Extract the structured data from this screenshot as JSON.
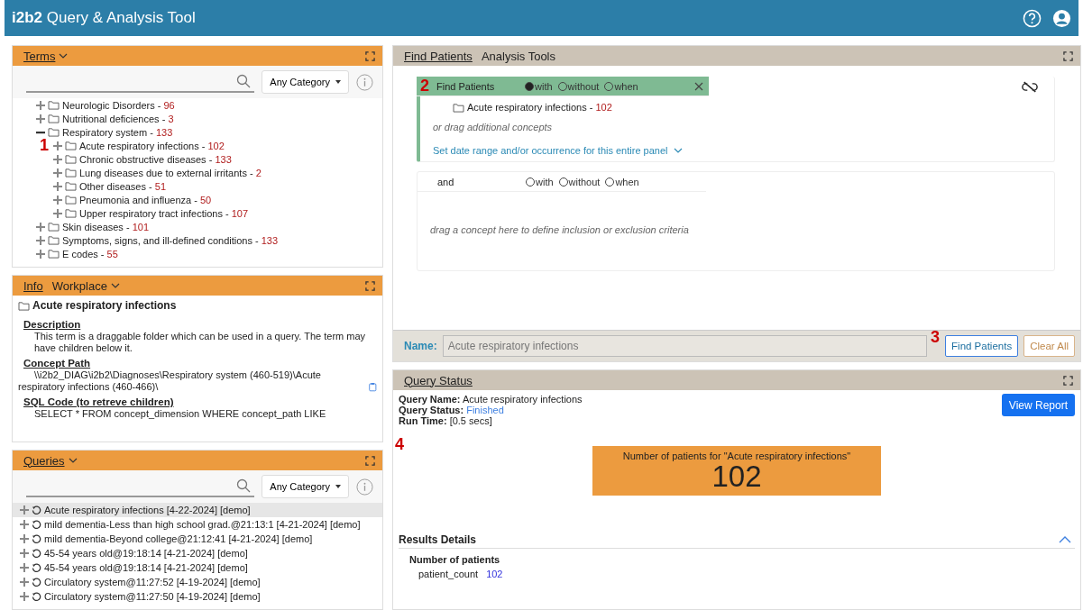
{
  "app_bar": {
    "title": "**i2b2** Query & Analysis Tool"
  },
  "terms_panel": {
    "tab": "Terms",
    "category": "Any Category",
    "tree": [
      {
        "label": "Neurologic Disorders -",
        "count": "96",
        "expanded": false
      },
      {
        "label": "Nutritional deficiences -",
        "count": "3",
        "expanded": false
      },
      {
        "label": "Respiratory system -",
        "count": "133",
        "expanded": true,
        "children": [
          {
            "label": "Acute respiratory infections -",
            "count": "102",
            "expanded": false,
            "marker": "1"
          },
          {
            "label": "Chronic obstructive diseases -",
            "count": "133",
            "expanded": false
          },
          {
            "label": "Lung diseases due to external irritants -",
            "count": "2",
            "expanded": false
          },
          {
            "label": "Other diseases -",
            "count": "51",
            "expanded": false
          },
          {
            "label": "Pneumonia and influenza -",
            "count": "50",
            "expanded": false
          },
          {
            "label": "Upper respiratory tract infections -",
            "count": "107",
            "expanded": false
          }
        ]
      },
      {
        "label": "Skin diseases -",
        "count": "101",
        "expanded": false
      },
      {
        "label": "Symptoms, signs, and ill-defined conditions -",
        "count": "133",
        "expanded": false
      },
      {
        "label": "E codes -",
        "count": "55",
        "expanded": false
      }
    ]
  },
  "info_panel": {
    "tabs": [
      {
        "label": "Info",
        "selected": true
      },
      {
        "label": "Workplace",
        "selected": false
      }
    ],
    "title": "Acute respiratory infections",
    "sections": [
      {
        "heading": "Description",
        "text": "This term is a draggable folder which can be used in a query. The term may have children below it.",
        "kind": "text"
      },
      {
        "heading": "Concept Path",
        "text": "\\\\i2b2_DIAG\\i2b2\\Diagnoses\\Respiratory system (460-519)\\Acute respiratory infections (460-466)\\",
        "kind": "path"
      },
      {
        "heading": "SQL Code (to retreve children)",
        "text": "SELECT * FROM concept_dimension WHERE concept_path LIKE",
        "kind": "text"
      }
    ]
  },
  "queries_panel": {
    "tab": "Queries",
    "category": "Any Category",
    "rows": [
      {
        "label": "Acute respiratory infections [4-22-2024] [demo]",
        "selected": true
      },
      {
        "label": "mild dementia-Less than high school grad.@21:13:1 [4-21-2024] [demo]",
        "selected": false
      },
      {
        "label": "mild dementia-Beyond college@21:12:41 [4-21-2024] [demo]",
        "selected": false
      },
      {
        "label": "45-54 years old@19:18:14 [4-21-2024] [demo]",
        "selected": false
      },
      {
        "label": "45-54 years old@19:18:14 [4-21-2024] [demo]",
        "selected": false
      },
      {
        "label": "Circulatory system@11:27:52 [4-19-2024] [demo]",
        "selected": false
      },
      {
        "label": "Circulatory system@11:27:50 [4-19-2024] [demo]",
        "selected": false
      }
    ]
  },
  "query_panel": {
    "tabs": [
      {
        "label": "Find Patients",
        "selected": true
      },
      {
        "label": "Analysis Tools",
        "selected": false
      }
    ],
    "groups": [
      {
        "marker": "2",
        "title": "Find Patients",
        "active": true,
        "options": [
          {
            "label": "with",
            "selected": true
          },
          {
            "label": "without",
            "selected": false
          },
          {
            "label": "when",
            "selected": false
          }
        ],
        "concepts": [
          {
            "label": "Acute respiratory infections -",
            "count": "102"
          }
        ],
        "hint": "or drag additional concepts",
        "date_link": "Set date range and/or occurrence for this entire panel"
      },
      {
        "title": "and",
        "active": false,
        "options": [
          {
            "label": "with",
            "selected": false
          },
          {
            "label": "without",
            "selected": false
          },
          {
            "label": "when",
            "selected": false
          }
        ],
        "hint": "drag a concept here to define inclusion or exclusion criteria"
      }
    ],
    "name_label": "Name:",
    "name_value": "Acute respiratory infections",
    "marker": "3",
    "find_button": "Find Patients",
    "clear_button": "Clear All"
  },
  "status_panel": {
    "title": "Query Status",
    "fields": [
      {
        "label": "Query Name:",
        "value": "Acute respiratory infections",
        "kind": "plain"
      },
      {
        "label": "Query Status:",
        "value": "Finished",
        "kind": "status"
      },
      {
        "label": "Run Time:",
        "value": "[0.5   secs]",
        "kind": "plain"
      }
    ],
    "view_report": "View Report",
    "marker": "4",
    "result_caption": "Number of patients for \"Acute respiratory infections\"",
    "result_count": "102",
    "details_heading": "Results Details",
    "details_subheading": "Number of patients",
    "details_rows": [
      {
        "key": "patient_count",
        "value": "102"
      }
    ]
  }
}
